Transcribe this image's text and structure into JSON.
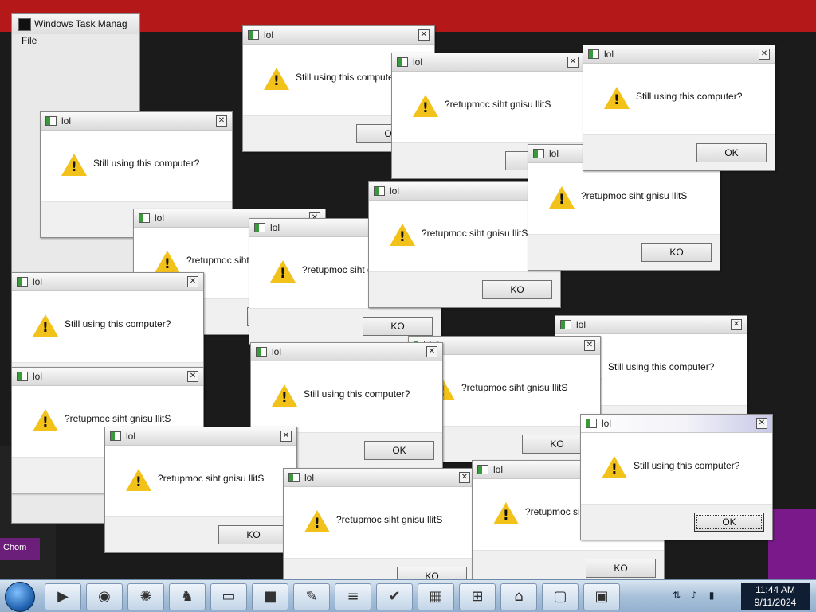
{
  "taskmgr": {
    "title": "Windows Task Manag",
    "menu_file": "File"
  },
  "chrome_tab": {
    "label": "Chom"
  },
  "windows": [
    {
      "title": "lol",
      "message": "Still using this computer?",
      "button": "OK"
    },
    {
      "title": "lol",
      "message": "?retupmoc siht gnisu llitS",
      "button": "KO"
    },
    {
      "title": "lol",
      "message": "Still using this computer?",
      "button": "OK"
    },
    {
      "title": "lol",
      "message": "?retupmoc siht gnisu llitS",
      "button": "KO"
    },
    {
      "title": "lol",
      "message": "Still using this computer?",
      "button": "OK"
    },
    {
      "title": "lol",
      "message": "?retupmoc siht gnisu llitS",
      "button": "KO"
    },
    {
      "title": "lol",
      "message": "?retupmoc siht gnisu llitS",
      "button": "KO"
    },
    {
      "title": "lol",
      "message": "?retupmoc siht gnisu llitS",
      "button": "KO"
    },
    {
      "title": "lol",
      "message": "Still using this computer?",
      "button": "OK"
    },
    {
      "title": "lol",
      "message": "?retupmoc siht gnisu llitS",
      "button": "KO"
    },
    {
      "title": "lol",
      "message": "?retupmoc siht gnisu llitS",
      "button": "KO"
    },
    {
      "title": "lol",
      "message": "Still using this computer?",
      "button": "OK"
    },
    {
      "title": "lol",
      "message": "Still using this computer?",
      "button": "OK"
    },
    {
      "title": "lol",
      "message": "?retupmoc siht gnisu llitS",
      "button": "KO"
    },
    {
      "title": "lol",
      "message": "?retupmoc siht gnisu llitS",
      "button": "KO"
    },
    {
      "title": "lol",
      "message": "?retupmoc siht gnisu llitS",
      "button": "KO"
    },
    {
      "title": "lol",
      "message": "Still using this computer?",
      "button": "OK"
    }
  ],
  "taskbar": {
    "icons": [
      "media-player-icon",
      "globe-icon",
      "firefox-icon",
      "game-icon",
      "folder-icon",
      "blackbox-icon",
      "paint-icon",
      "notepad-icon",
      "check-icon",
      "maze-icon",
      "calculator-icon",
      "monitor-icon",
      "window-icon",
      "display-icon"
    ],
    "tray_icons": [
      "network-icon",
      "speaker-icon",
      "device-icon"
    ],
    "time": "11:44 AM",
    "date": "9/11/2024"
  },
  "colors": {
    "warning": "#f2c21b",
    "taskbar": "#a9c1da",
    "clock_bg": "#0f1e33"
  }
}
